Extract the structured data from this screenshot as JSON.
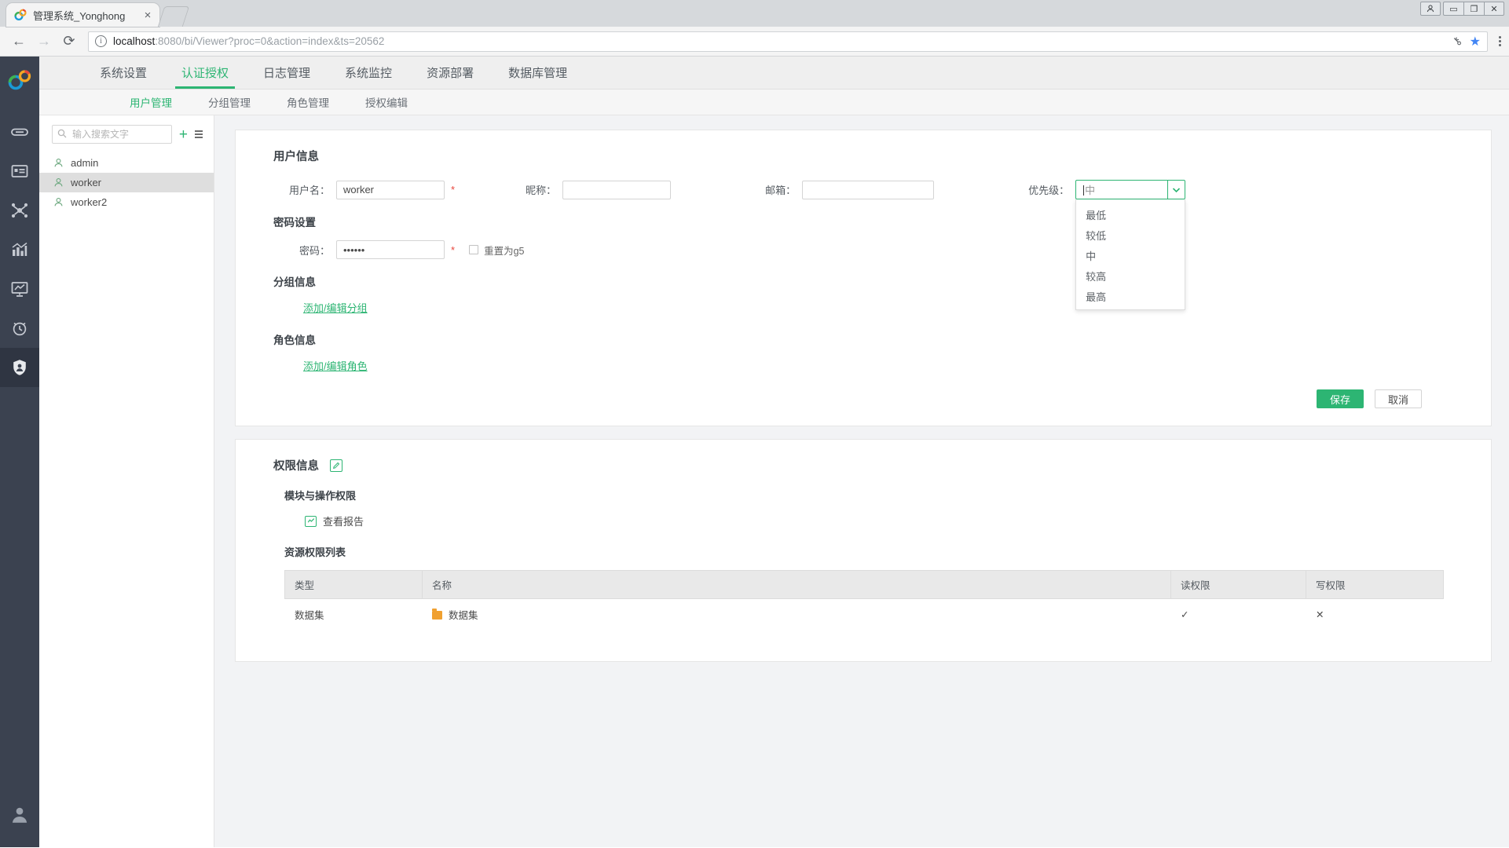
{
  "browser": {
    "tab_title": "管理系统_Yonghong",
    "tab_close": "×",
    "back_icon": "←",
    "forward_icon": "→",
    "reload_icon": "⟳",
    "info_icon": "i",
    "url_scheme_host": "localhost",
    "url_rest": ":8080/bi/Viewer?proc=0&action=index&ts=20562",
    "key_icon": "⚷",
    "star_icon": "★",
    "menu_icon": "⋮",
    "win_min": "▭",
    "win_max": "❐",
    "win_close": "✕",
    "win_user": "👤"
  },
  "rail": {
    "items": [
      {
        "name": "logo",
        "label": "Yonghong"
      },
      {
        "name": "link",
        "label": "数据源"
      },
      {
        "name": "card",
        "label": "数据集"
      },
      {
        "name": "network",
        "label": "数据建模"
      },
      {
        "name": "chart",
        "label": "制作报告"
      },
      {
        "name": "presentation",
        "label": "报告展示"
      },
      {
        "name": "alarm",
        "label": "定时任务"
      },
      {
        "name": "shield",
        "label": "管理系统"
      }
    ],
    "bottom": {
      "name": "account",
      "label": "用户"
    }
  },
  "topnav": {
    "items": [
      {
        "label": "系统设置",
        "active": false
      },
      {
        "label": "认证授权",
        "active": true
      },
      {
        "label": "日志管理",
        "active": false
      },
      {
        "label": "系统监控",
        "active": false
      },
      {
        "label": "资源部署",
        "active": false
      },
      {
        "label": "数据库管理",
        "active": false
      }
    ]
  },
  "subnav": {
    "items": [
      {
        "label": "用户管理",
        "active": true
      },
      {
        "label": "分组管理",
        "active": false
      },
      {
        "label": "角色管理",
        "active": false
      },
      {
        "label": "授权编辑",
        "active": false
      }
    ]
  },
  "userpanel": {
    "search_placeholder": "输入搜索文字",
    "search_value": "",
    "add_icon": "+",
    "menu_icon": "≡",
    "users": [
      {
        "name": "admin",
        "selected": false
      },
      {
        "name": "worker",
        "selected": true
      },
      {
        "name": "worker2",
        "selected": false
      }
    ]
  },
  "user_info": {
    "title": "用户信息",
    "username_label": "用户名：",
    "username_value": "worker",
    "username_required": "*",
    "nickname_label": "昵称：",
    "nickname_value": "",
    "email_label": "邮箱：",
    "email_value": "",
    "priority_label": "优先级：",
    "priority_value": "中",
    "priority_arrow": "⌄",
    "priority_options": [
      "最低",
      "较低",
      "中",
      "较高",
      "最高"
    ],
    "password_section": "密码设置",
    "password_label": "密码：",
    "password_value": "••••••",
    "password_required": "*",
    "reset_checkbox_label": "重置为g5",
    "reset_checked": false,
    "group_section": "分组信息",
    "group_link": "添加/编辑分组",
    "role_section": "角色信息",
    "role_link": "添加/编辑角色",
    "save_label": "保存",
    "cancel_label": "取消"
  },
  "permission_info": {
    "title": "权限信息",
    "edit_icon": "✎",
    "module_section": "模块与操作权限",
    "module_items": [
      {
        "label": "查看报告",
        "icon": "chart-badge"
      }
    ],
    "resource_section": "资源权限列表",
    "table": {
      "headers": [
        "类型",
        "名称",
        "读权限",
        "写权限"
      ],
      "rows": [
        {
          "type": "数据集",
          "name": "数据集",
          "read": "✓",
          "write": "✕"
        }
      ]
    }
  }
}
